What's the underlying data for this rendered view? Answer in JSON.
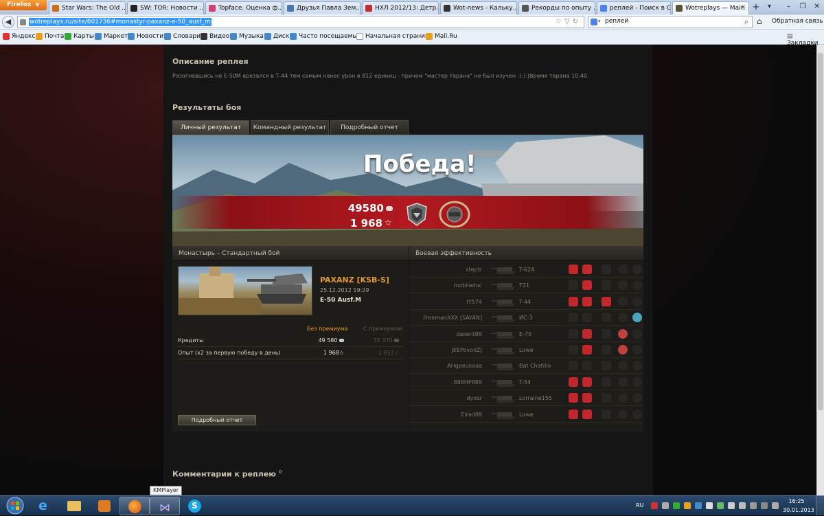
{
  "browser": {
    "menu_button": "Firefox",
    "tabs": [
      {
        "label": "Star Wars: The Old ...",
        "fav": "#c8701a"
      },
      {
        "label": "SW: TOR: Новости ...",
        "fav": "#222222"
      },
      {
        "label": "Topface. Оценка ф...",
        "fav": "#d04070"
      },
      {
        "label": "Друзья Павла Зем...",
        "fav": "#4a76a8"
      },
      {
        "label": "НХЛ 2012/13: Детр...",
        "fav": "#c03030"
      },
      {
        "label": "Wot-news - Кальку...",
        "fav": "#333333"
      },
      {
        "label": "Рекорды по опыту ...",
        "fav": "#555555"
      },
      {
        "label": "реплей - Поиск в G...",
        "fav": "#4a83ec"
      },
      {
        "label": "Wotreplays — Main",
        "fav": "#555533"
      }
    ],
    "url": "wotreplays.ru/site/601736#monastyr-paxanz-e-50_ausf_m",
    "search_text": "реплей",
    "feedback": "Обратная связь",
    "bookmarks": [
      "Яндекс",
      "Почта",
      "Карты",
      "Маркет",
      "Новости",
      "Словари",
      "Видео",
      "Музыка",
      "Диск",
      "Часто посещаемые",
      "Начальная страница",
      "Mail.Ru"
    ],
    "bookmarks_right": "Закладки"
  },
  "replay": {
    "desc_title": "Описание реплея",
    "desc_text": "Разогнавшись на Е-50М врезался в Т-44 тем самым нанес урон в 812 единиц - причем \"мастер тарана\" не был изучен :):):)Время тарана 10.40.",
    "results_title": "Результаты боя",
    "tabs": [
      "Личный результат",
      "Командный результат",
      "Подробный отчет"
    ],
    "victory": "Победа!",
    "banner_credits": "49580",
    "banner_exp": "1 968",
    "star": "☆",
    "map_header": "Монастырь – Стандартный бой",
    "eff_header": "Боевая эффективность",
    "player": "PAXANZ [KSB-S]",
    "date": "25.12.2012 19:29",
    "tank": "E-50 Ausf.M",
    "col_no_premium": "Без премиума",
    "col_premium": "С премиумом",
    "stats": [
      {
        "label": "Кредиты",
        "v1": "49 580",
        "v2": "74 370"
      },
      {
        "label": "Опыт (х2 за первую победу в день)",
        "v1": "1 968",
        "v2": "2 952"
      }
    ],
    "detail_button": "Подробный отчет",
    "comments_title": "Комментарии к реплею",
    "comments_count": "0",
    "colors": {
      "gold": "#e59a2a",
      "red": "#b31920"
    }
  },
  "efficiency": [
    {
      "player": "steptr",
      "tank": "T-62A"
    },
    {
      "player": "mobiledoc",
      "tank": "T21"
    },
    {
      "player": "IYS74",
      "tank": "T-44"
    },
    {
      "player": "FreemanXXX [SAYAN]",
      "tank": "ИС-3"
    },
    {
      "player": "dasent88",
      "tank": "E-75"
    },
    {
      "player": "JEEPovodZJ",
      "tank": "Lowe"
    },
    {
      "player": "AHgpeukaaa",
      "tank": "Bat Chatillo"
    },
    {
      "player": "888HP888",
      "tank": "T-54"
    },
    {
      "player": "dyxer",
      "tank": "Lorraine155"
    },
    {
      "player": "Elrad88",
      "tank": "Lowe"
    }
  ],
  "taskbar": {
    "tooltip": "KMPlayer",
    "lang": "RU",
    "time": "16:25",
    "date": "30.01.2013"
  }
}
